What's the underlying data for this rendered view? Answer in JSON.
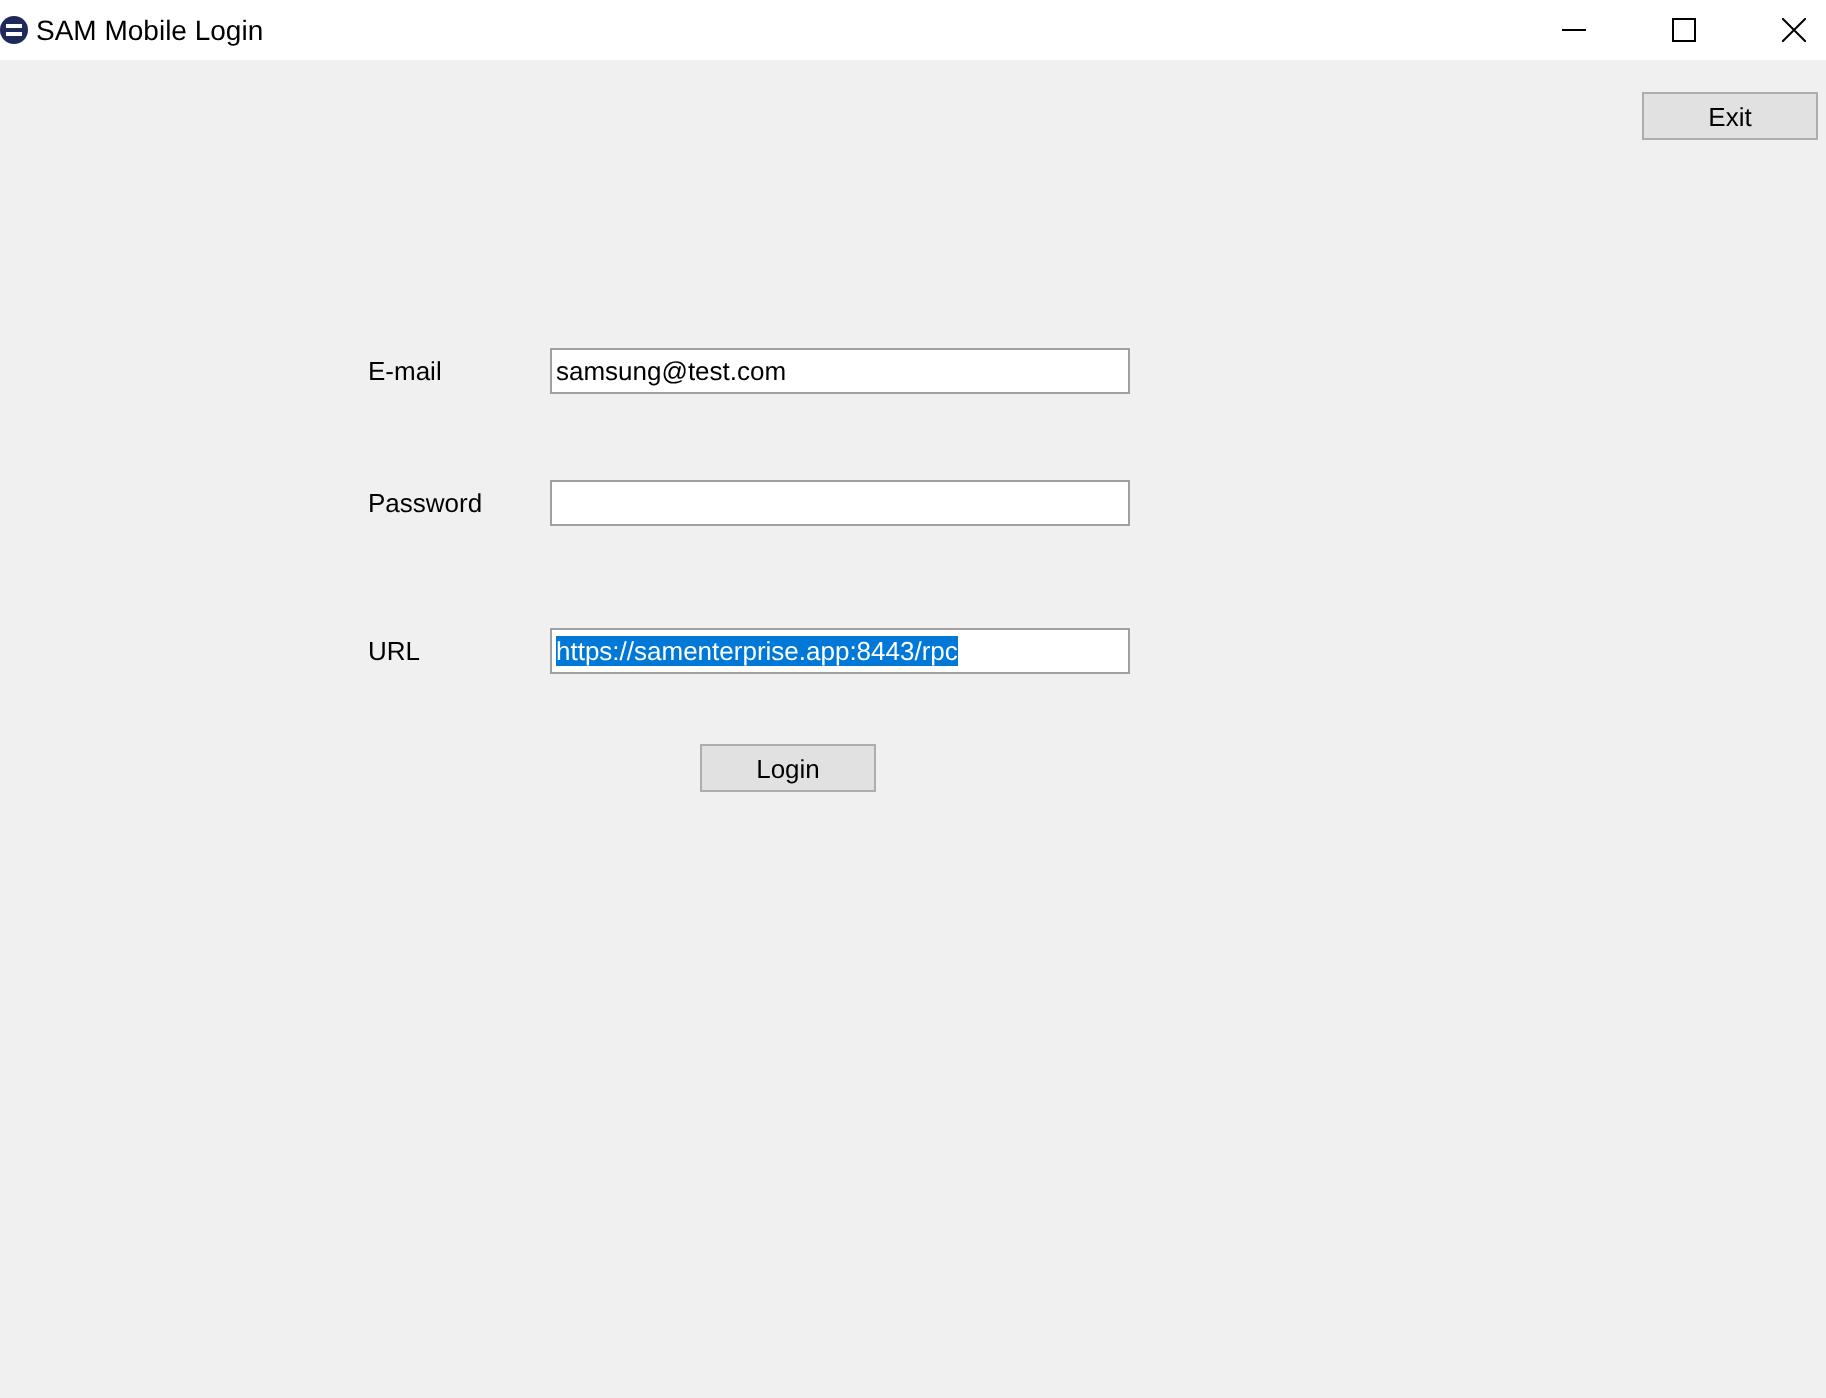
{
  "window": {
    "title": "SAM Mobile Login"
  },
  "exit_button": "Exit",
  "fields": [
    {
      "label": "E-mail",
      "value": "samsung@test.com"
    },
    {
      "label": "Password"
    },
    {
      "label": "URL",
      "value": "https://samenterprise.app:8443/rpc",
      "text_selected": true
    }
  ],
  "login_button": "Login"
}
